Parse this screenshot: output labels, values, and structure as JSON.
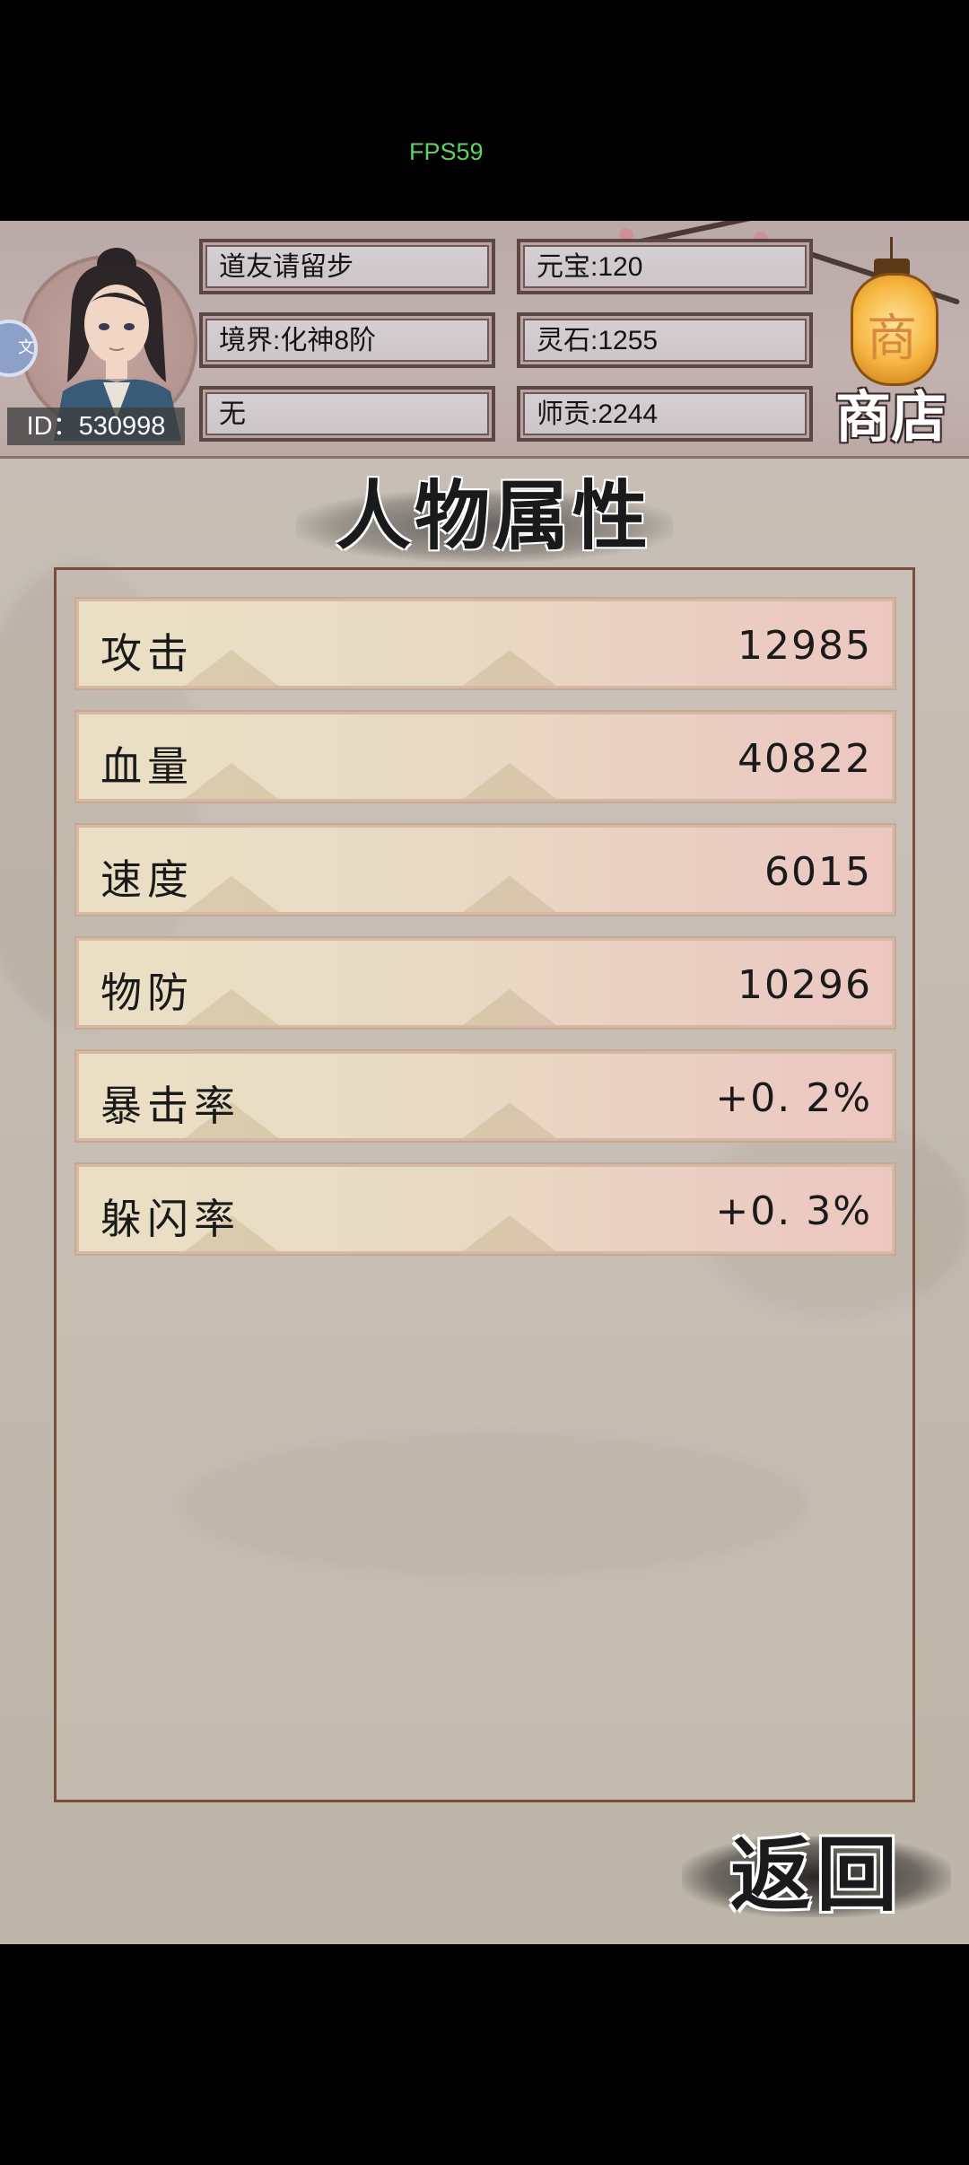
{
  "overlay": {
    "fps": "FPS59"
  },
  "header": {
    "player_id": "ID：530998",
    "name": "道友请留步",
    "realm": "境界:化神8阶",
    "extra": "无",
    "yuanbao": "元宝:120",
    "lingshi": "灵石:1255",
    "shigong": "师贡:2244",
    "shop_lantern_char": "商",
    "shop_label": "商店",
    "side_badge": "文"
  },
  "page": {
    "title": "人物属性",
    "back_label": "返回"
  },
  "stats": [
    {
      "label": "攻击",
      "value": "12985"
    },
    {
      "label": "血量",
      "value": "40822"
    },
    {
      "label": "速度",
      "value": "6015"
    },
    {
      "label": "物防",
      "value": "10296"
    },
    {
      "label": "暴击率",
      "value": "+0. 2%"
    },
    {
      "label": "躲闪率",
      "value": "+0. 3%"
    }
  ],
  "colors": {
    "panel_border": "#7a4e3a",
    "fps_text": "#5fd35f",
    "row_left": "#eadfc5",
    "row_right": "#ecc7c0"
  }
}
